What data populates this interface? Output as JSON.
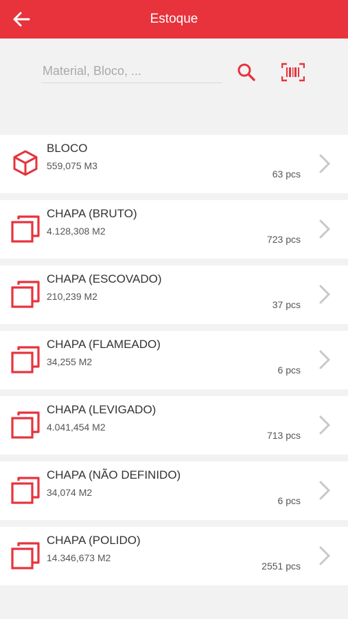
{
  "header": {
    "title": "Estoque",
    "back_icon": "arrow-left-icon"
  },
  "search": {
    "placeholder": "Material, Bloco, ...",
    "value": "",
    "search_icon": "search-icon",
    "barcode_icon": "barcode-scan-icon"
  },
  "colors": {
    "accent": "#e8323c",
    "background": "#f2f2f2",
    "card": "#ffffff",
    "chevron": "#c8c8c8"
  },
  "items": [
    {
      "icon": "cube-icon",
      "name": "BLOCO",
      "qty": "559,075 M3",
      "pcs": "63 pcs"
    },
    {
      "icon": "slab-icon",
      "name": "CHAPA (BRUTO)",
      "qty": "4.128,308 M2",
      "pcs": "723 pcs"
    },
    {
      "icon": "slab-icon",
      "name": "CHAPA (ESCOVADO)",
      "qty": "210,239 M2",
      "pcs": "37 pcs"
    },
    {
      "icon": "slab-icon",
      "name": "CHAPA (FLAMEADO)",
      "qty": "34,255 M2",
      "pcs": "6 pcs"
    },
    {
      "icon": "slab-icon",
      "name": "CHAPA (LEVIGADO)",
      "qty": "4.041,454 M2",
      "pcs": "713 pcs"
    },
    {
      "icon": "slab-icon",
      "name": "CHAPA (NÃO DEFINIDO)",
      "qty": "34,074 M2",
      "pcs": "6 pcs"
    },
    {
      "icon": "slab-icon",
      "name": "CHAPA (POLIDO)",
      "qty": "14.346,673 M2",
      "pcs": "2551 pcs"
    }
  ]
}
